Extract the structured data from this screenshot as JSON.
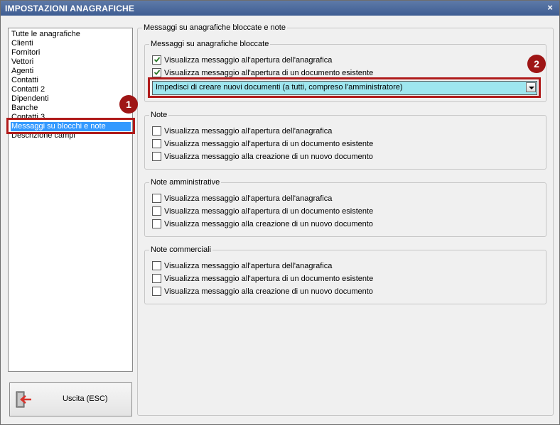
{
  "window": {
    "title": "IMPOSTAZIONI ANAGRAFICHE",
    "close_glyph": "×"
  },
  "sidebar": {
    "items": [
      {
        "label": "Tutte le anagrafiche"
      },
      {
        "label": "Clienti"
      },
      {
        "label": "Fornitori"
      },
      {
        "label": "Vettori"
      },
      {
        "label": "Agenti"
      },
      {
        "label": "Contatti"
      },
      {
        "label": "Contatti 2"
      },
      {
        "label": "Dipendenti"
      },
      {
        "label": "Banche"
      },
      {
        "label": "Contatti 3"
      },
      {
        "label": "Messaggi su blocchi e note",
        "selected": true
      },
      {
        "label": "Descrizione campi"
      }
    ]
  },
  "exit_button": {
    "label": "Uscita (ESC)",
    "icon": "exit-door-icon"
  },
  "main": {
    "group_title": "Messaggi su anagrafiche bloccate e note",
    "blocked": {
      "title": "Messaggi su anagrafiche bloccate",
      "checkboxes": [
        {
          "label": "Visualizza messaggio all'apertura dell'anagrafica",
          "checked": true
        },
        {
          "label": "Visualizza messaggio all'apertura di un documento esistente",
          "checked": true
        }
      ],
      "combo": {
        "value": "Impedisci di creare nuovi documenti (a tutti, compreso l'amministratore)"
      }
    },
    "note": {
      "title": "Note",
      "checkboxes": [
        {
          "label": "Visualizza messaggio all'apertura dell'anagrafica",
          "checked": false
        },
        {
          "label": "Visualizza messaggio all'apertura di un documento esistente",
          "checked": false
        },
        {
          "label": "Visualizza messaggio alla creazione di un nuovo documento",
          "checked": false
        }
      ]
    },
    "note_amministrative": {
      "title": "Note amministrative",
      "checkboxes": [
        {
          "label": "Visualizza messaggio all'apertura dell'anagrafica",
          "checked": false
        },
        {
          "label": "Visualizza messaggio all'apertura di un documento esistente",
          "checked": false
        },
        {
          "label": "Visualizza messaggio alla creazione di un nuovo documento",
          "checked": false
        }
      ]
    },
    "note_commerciali": {
      "title": "Note commerciali",
      "checkboxes": [
        {
          "label": "Visualizza messaggio all'apertura dell'anagrafica",
          "checked": false
        },
        {
          "label": "Visualizza messaggio all'apertura di un documento esistente",
          "checked": false
        },
        {
          "label": "Visualizza messaggio alla creazione di un nuovo documento",
          "checked": false
        }
      ]
    }
  },
  "annotations": {
    "badge1": "1",
    "badge2": "2",
    "color": "#b01b1b"
  }
}
